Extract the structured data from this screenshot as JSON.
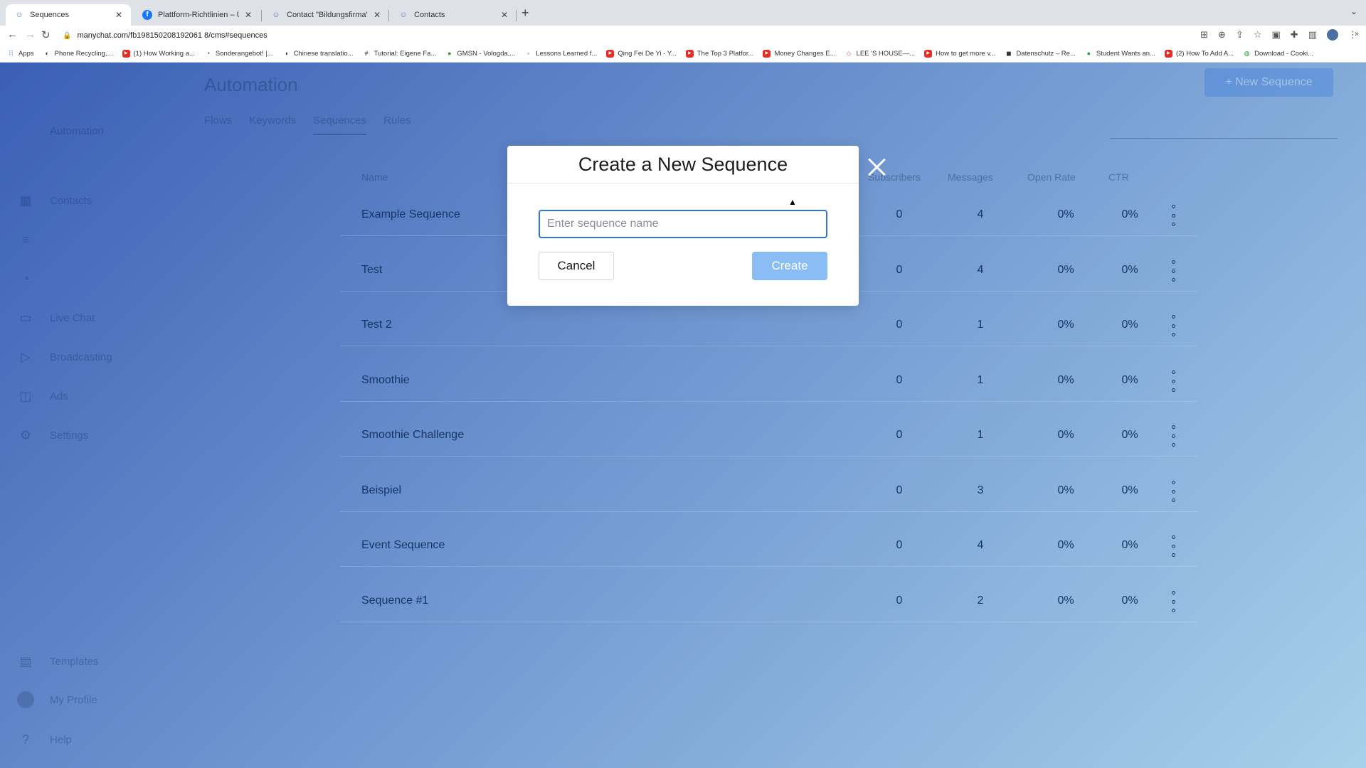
{
  "browser": {
    "tabs": [
      {
        "title": "Sequences",
        "icon": "manychat-icon",
        "active": true
      },
      {
        "title": "Plattform-Richtlinien – Übersicht",
        "icon": "facebook-icon",
        "active": false
      },
      {
        "title": "Contact \"Bildungsfirma\" through",
        "icon": "manychat-icon",
        "active": false
      },
      {
        "title": "Contacts",
        "icon": "manychat-icon",
        "active": false
      }
    ],
    "url": "manychat.com/fb198150208192061 8/cms#sequences",
    "bookmarks": [
      {
        "label": "Apps",
        "icon": "apps-grid-icon"
      },
      {
        "label": "Phone Recycling,...",
        "icon": "globe-icon"
      },
      {
        "label": "(1) How Working a...",
        "icon": "youtube-icon"
      },
      {
        "label": "Sonderangebot! |...",
        "icon": "globe-icon"
      },
      {
        "label": "Chinese translatio...",
        "icon": "globe-icon"
      },
      {
        "label": "Tutorial: Eigene Fa...",
        "icon": "hashtag-icon"
      },
      {
        "label": "GMSN - Vologda,...",
        "icon": "globe-icon"
      },
      {
        "label": "Lessons Learned f...",
        "icon": "globe-icon"
      },
      {
        "label": "Qing Fei De Yi - Y...",
        "icon": "youtube-icon"
      },
      {
        "label": "The Top 3 Platfor...",
        "icon": "youtube-icon"
      },
      {
        "label": "Money Changes E...",
        "icon": "youtube-icon"
      },
      {
        "label": "LEE 'S HOUSE—...",
        "icon": "airbnb-icon"
      },
      {
        "label": "How to get more v...",
        "icon": "youtube-icon"
      },
      {
        "label": "Datenschutz – Re...",
        "icon": "globe-icon"
      },
      {
        "label": "Student Wants an...",
        "icon": "globe-icon"
      },
      {
        "label": "(2) How To Add A...",
        "icon": "youtube-icon"
      },
      {
        "label": "Download - Cooki...",
        "icon": "globe-icon"
      }
    ]
  },
  "page": {
    "title": "Automation",
    "subtabs": [
      "Flows",
      "Keywords",
      "Sequences",
      "Rules"
    ],
    "active_subtab": "Sequences",
    "new_sequence_label": "+ New Sequence",
    "sidebar": {
      "top": [
        "Automation",
        "Contacts",
        "Live Chat",
        "Broadcasting",
        "Ads",
        "Settings"
      ],
      "top_icons": [
        "automation-icon",
        "contacts-icon",
        "growth-icon",
        "chat-icon",
        "broadcast-icon",
        "ads-icon",
        "gear-icon"
      ],
      "bottom": [
        {
          "label": "Templates",
          "icon": "templates-icon"
        },
        {
          "label": "My Profile",
          "icon": "avatar-icon"
        },
        {
          "label": "Help",
          "icon": "help-icon"
        }
      ]
    },
    "table": {
      "columns": {
        "name": "Name",
        "subscribers": "Subscribers",
        "messages": "Messages",
        "open_rate": "Open Rate",
        "ctr": "CTR"
      },
      "rows": [
        {
          "name": "Example Sequence",
          "subscribers": "0",
          "messages": "4",
          "open_rate": "0%",
          "ctr": "0%"
        },
        {
          "name": "Test",
          "subscribers": "0",
          "messages": "4",
          "open_rate": "0%",
          "ctr": "0%"
        },
        {
          "name": "Test 2",
          "subscribers": "0",
          "messages": "1",
          "open_rate": "0%",
          "ctr": "0%"
        },
        {
          "name": "Smoothie",
          "subscribers": "0",
          "messages": "1",
          "open_rate": "0%",
          "ctr": "0%"
        },
        {
          "name": "Smoothie Challenge",
          "subscribers": "0",
          "messages": "1",
          "open_rate": "0%",
          "ctr": "0%"
        },
        {
          "name": "Beispiel",
          "subscribers": "0",
          "messages": "3",
          "open_rate": "0%",
          "ctr": "0%"
        },
        {
          "name": "Event Sequence",
          "subscribers": "0",
          "messages": "4",
          "open_rate": "0%",
          "ctr": "0%"
        },
        {
          "name": "Sequence #1",
          "subscribers": "0",
          "messages": "2",
          "open_rate": "0%",
          "ctr": "0%"
        }
      ]
    }
  },
  "modal": {
    "title": "Create a New Sequence",
    "input_placeholder": "Enter sequence name",
    "input_value": "",
    "cancel_label": "Cancel",
    "create_label": "Create"
  },
  "colors": {
    "accent": "#2f74e0",
    "create_disabled": "#89bdf3",
    "backdrop_from": "#3a5fb5",
    "backdrop_to": "#a7d0ea"
  }
}
